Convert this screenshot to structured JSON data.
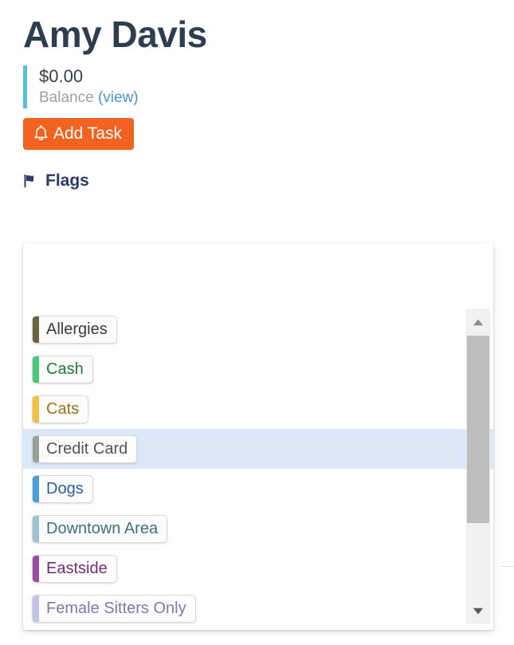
{
  "profile": {
    "name": "Amy Davis"
  },
  "balance": {
    "amount": "$0.00",
    "caption": "Balance",
    "view_link": "(view)",
    "accent_color": "#5bc0de"
  },
  "actions": {
    "add_task_label": "Add Task",
    "add_task_icon": "bell-icon",
    "add_task_color": "#f26322"
  },
  "flags_section": {
    "heading": "Flags",
    "heading_icon": "flag-icon",
    "heading_color": "#2b3a67",
    "selected_flag": "Credit Card",
    "selection_color": "#dce8f7",
    "items": [
      {
        "label": "Allergies",
        "swatch": "#6b6340",
        "text_color": "#3a3a3a"
      },
      {
        "label": "Cash",
        "swatch": "#4bc77a",
        "text_color": "#1f7a3d"
      },
      {
        "label": "Cats",
        "swatch": "#f3c040",
        "text_color": "#9a7214"
      },
      {
        "label": "Credit Card",
        "swatch": "#9a9d9e",
        "text_color": "#4d5659"
      },
      {
        "label": "Dogs",
        "swatch": "#4a9fdb",
        "text_color": "#2b5f9e"
      },
      {
        "label": "Downtown Area",
        "swatch": "#9cc3d2",
        "text_color": "#3f7081"
      },
      {
        "label": "Eastside",
        "swatch": "#9c4ca5",
        "text_color": "#6b2e78"
      },
      {
        "label": "Female Sitters Only",
        "swatch": "#c3c3e8",
        "text_color": "#7b7bb0"
      }
    ]
  },
  "scrollbar": {
    "up_arrow_icon": "triangle-up-icon",
    "down_arrow_icon": "triangle-down-icon",
    "thumb_color": "#bdbdbd",
    "track_color": "#f1f1f1"
  }
}
